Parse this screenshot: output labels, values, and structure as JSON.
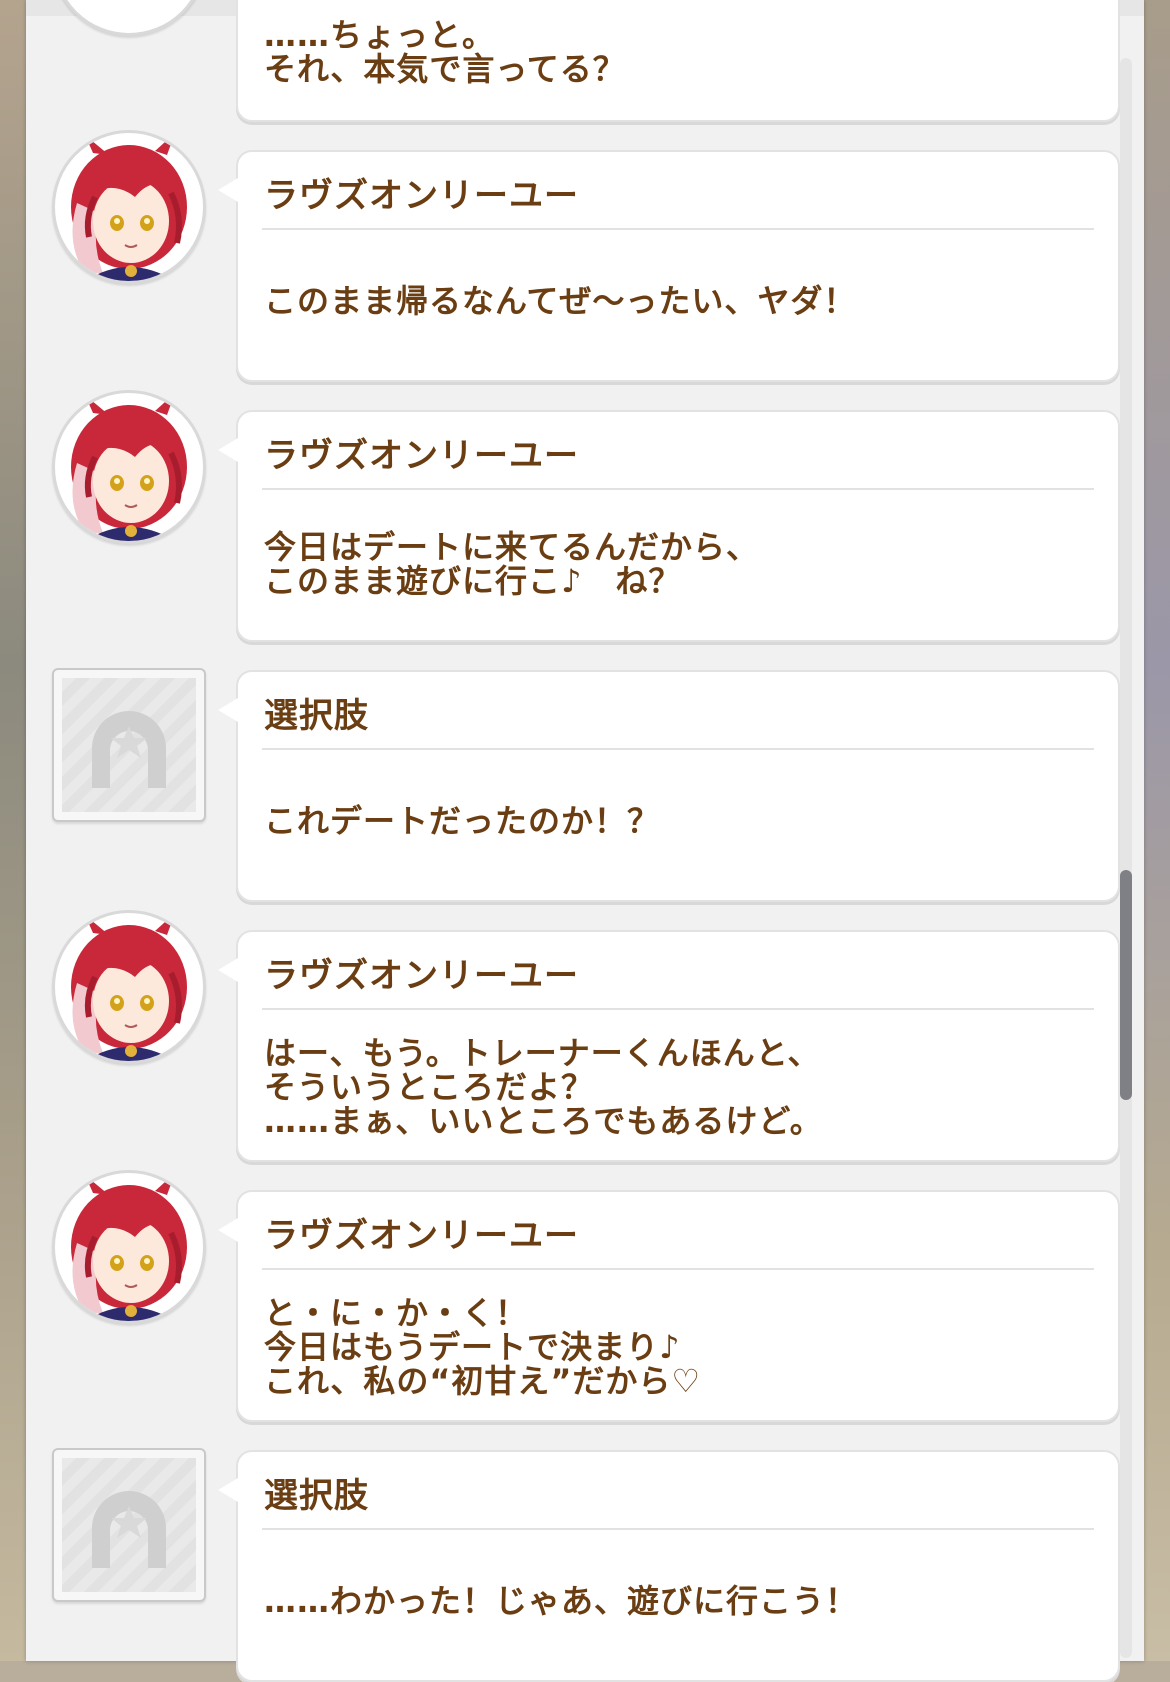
{
  "messages": [
    {
      "speaker": "",
      "avatar": "character",
      "text": "……ちょっと。\nそれ、本気で言ってる？"
    },
    {
      "speaker": "ラヴズオンリーユー",
      "avatar": "character",
      "text": "このまま帰るなんてぜ～ったい、ヤダ！"
    },
    {
      "speaker": "ラヴズオンリーユー",
      "avatar": "character",
      "text": "今日はデートに来てるんだから、\nこのまま遊びに行こ♪　ね？"
    },
    {
      "speaker": "選択肢",
      "avatar": "choice",
      "text": "これデートだったのか！？"
    },
    {
      "speaker": "ラヴズオンリーユー",
      "avatar": "character",
      "text": "はー、もう。トレーナーくんほんと、\nそういうところだよ？\n……まぁ、いいところでもあるけど。"
    },
    {
      "speaker": "ラヴズオンリーユー",
      "avatar": "character",
      "text": "と・に・か・く！\n今日はもうデートで決まり♪\nこれ、私の“初甘え”だから♡"
    },
    {
      "speaker": "選択肢",
      "avatar": "choice",
      "text": "……わかった！じゃあ、遊びに行こう！"
    }
  ],
  "colors": {
    "text": "#6a3e12",
    "panel": "#f1f1f1",
    "bubble": "#ffffff",
    "hair": "#c8283a",
    "hair_light": "#f1c9cf"
  },
  "icons": {
    "choice_avatar": "horseshoe-star-icon",
    "character_avatar": "horse-girl-portrait-icon"
  }
}
